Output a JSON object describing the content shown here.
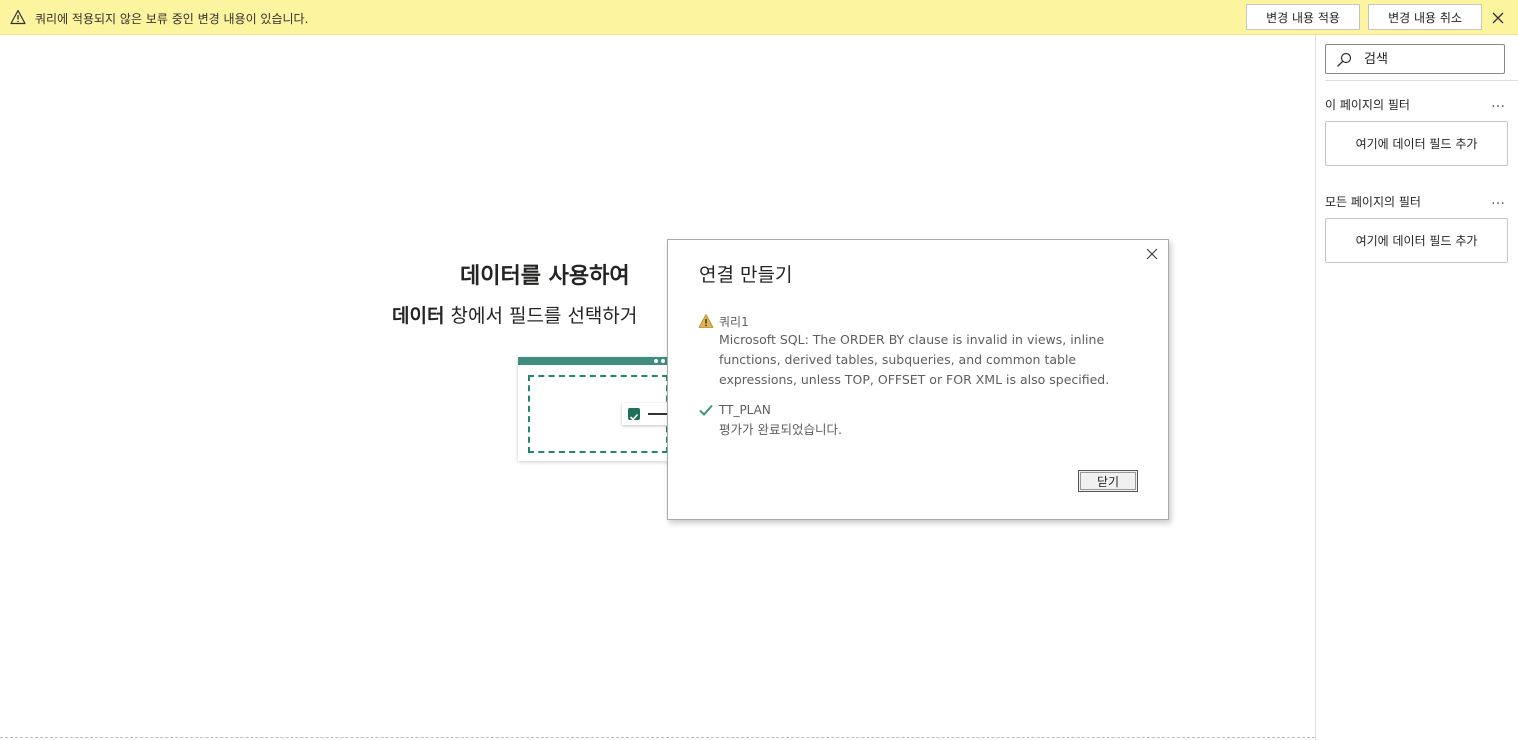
{
  "warning_bar": {
    "message": "쿼리에 적용되지 않은 보류 중인 변경 내용이 있습니다.",
    "apply_label": "변경 내용 적용",
    "discard_label": "변경 내용 취소",
    "bg_color": "#fcf49f"
  },
  "canvas": {
    "title": "데이터를 사용하여",
    "subtitle_bold": "데이터",
    "subtitle_rest": " 창에서 필드를 선택하거"
  },
  "filters": {
    "search_placeholder": "검색",
    "page_section": {
      "title": "이 페이지의 필터",
      "more": "…",
      "drop_label": "여기에 데이터 필드 추가"
    },
    "all_pages_section": {
      "title": "모든 페이지의 필터",
      "more": "…",
      "drop_label": "여기에 데이터 필드 추가"
    }
  },
  "dialog": {
    "title": "연결 만들기",
    "entries": [
      {
        "status": "warning",
        "icon": "warning-icon",
        "name": "쿼리1",
        "message": "Microsoft SQL: The ORDER BY clause is invalid in views, inline functions, derived tables, subqueries, and common table expressions, unless TOP, OFFSET or FOR XML is also specified."
      },
      {
        "status": "success",
        "icon": "checkmark-icon",
        "name": "TT_PLAN",
        "message": "평가가 완료되었습니다."
      }
    ],
    "close_button_label": "닫기"
  },
  "colors": {
    "accent_green": "#3e8d7e",
    "check_green": "#2e8b57",
    "warning_amber": "#d9a536"
  }
}
